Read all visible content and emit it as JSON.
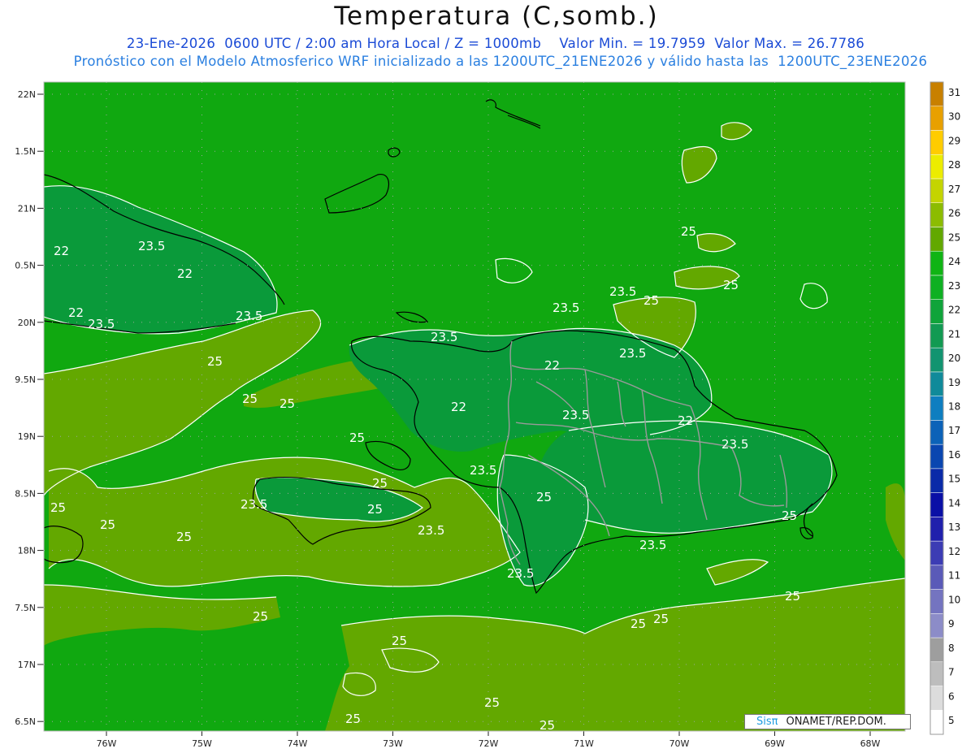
{
  "header": {
    "title": "Temperatura (C,somb.)",
    "line1": "23-Ene-2026  0600 UTC / 2:00 am Hora Local / Z = 1000mb    Valor Min. = 19.7959  Valor Max. = 26.7786",
    "line2": "Pronóstico con el Modelo Atmosferico WRF inicializado a las 1200UTC_21ENE2026 y válido hasta las  1200UTC_23ENE2026"
  },
  "lat_labels": [
    "22N",
    "21.5N",
    "21N",
    "20.5N",
    "20N",
    "19.5N",
    "19N",
    "18.5N",
    "18N",
    "17.5N",
    "17N",
    "16.5N"
  ],
  "lat_labels_display": [
    "22N",
    "1.5N",
    "21N",
    "0.5N",
    "20N",
    "9.5N",
    "19N",
    "8.5N",
    "18N",
    "7.5N",
    "17N",
    "6.5N"
  ],
  "lon_labels": [
    "76W",
    "75W",
    "74W",
    "73W",
    "72W",
    "71W",
    "70W",
    "69W",
    "68W"
  ],
  "colorbar": {
    "labels": [
      "5",
      "6",
      "7",
      "8",
      "9",
      "10",
      "11",
      "12",
      "13",
      "14",
      "15",
      "16",
      "17",
      "18",
      "19",
      "20",
      "21",
      "22",
      "23",
      "24",
      "25",
      "26",
      "27",
      "28",
      "29",
      "30",
      "31"
    ],
    "colors": [
      "#ffffff",
      "#dcdcdc",
      "#bdbdbd",
      "#9e9e9e",
      "#8c8cc8",
      "#7474c0",
      "#5a5ab8",
      "#3c3cb4",
      "#2020ac",
      "#0a10a6",
      "#0a2aa8",
      "#0a46b0",
      "#0c62b8",
      "#0e7ec0",
      "#108a9a",
      "#129470",
      "#129a52",
      "#10a43a",
      "#0eb022",
      "#10b414",
      "#62a800",
      "#8cbc00",
      "#c4d400",
      "#ecec00",
      "#ffcc00",
      "#e8a000",
      "#c88000"
    ]
  },
  "contour_labels": [
    "23.5",
    "22",
    "22",
    "23.5",
    "22",
    "23.5",
    "23.5",
    "25",
    "25",
    "25",
    "23.5",
    "23.5",
    "22",
    "22",
    "23.5",
    "22",
    "23.5",
    "25",
    "23.5",
    "23.5",
    "25",
    "25",
    "23.5",
    "25",
    "25",
    "25",
    "25",
    "23.5",
    "25",
    "23.5",
    "23.5",
    "25",
    "25",
    "25",
    "25",
    "25",
    "25",
    "25",
    "25",
    "25",
    "25",
    "25"
  ],
  "colors": {
    "sea_green": "#10a810",
    "land_green": "#0a9a3a",
    "olive": "#63a800",
    "contour": "#ffffff",
    "coast": "#000000",
    "border": "#999999",
    "header_blue": "#1b4bd6"
  },
  "credit": {
    "logo": "Sisπ",
    "text": "ONAMET/REP.DOM."
  }
}
